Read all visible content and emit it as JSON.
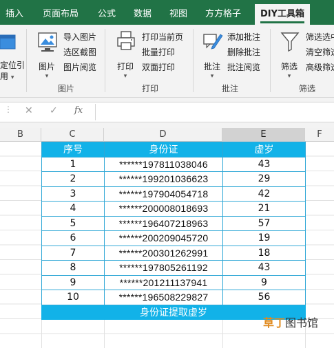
{
  "menu": {
    "tabs": [
      "插入",
      "页面布局",
      "公式",
      "数据",
      "视图",
      "方方格子",
      "DIY工具箱"
    ],
    "active_index": 6
  },
  "ribbon": {
    "partial_left": {
      "line1": "定位引",
      "line2": "用"
    },
    "groups": [
      {
        "label": "图片",
        "big": "图片",
        "small": [
          "导入图片",
          "选区截图",
          "图片阅览"
        ]
      },
      {
        "label": "打印",
        "big": "打印",
        "small": [
          "打印当前页",
          "批量打印",
          "双面打印"
        ]
      },
      {
        "label": "批注",
        "big": "批注",
        "small": [
          "添加批注",
          "删除批注",
          "批注阅览"
        ]
      },
      {
        "label": "筛选",
        "big": "筛选",
        "small": [
          "筛选选中",
          "清空筛选",
          "高级筛选"
        ]
      }
    ]
  },
  "formula_bar": {
    "fx": "fx",
    "value": ""
  },
  "sheet": {
    "columns": [
      "B",
      "C",
      "D",
      "E",
      "F"
    ],
    "selected_column": "E",
    "table": {
      "headers": [
        "序号",
        "身份证",
        "虚岁"
      ],
      "rows": [
        [
          "1",
          "******197811038046",
          "43"
        ],
        [
          "2",
          "******199201036623",
          "29"
        ],
        [
          "3",
          "******197904054718",
          "42"
        ],
        [
          "4",
          "******200008018693",
          "21"
        ],
        [
          "5",
          "******196407218963",
          "57"
        ],
        [
          "6",
          "******200209045720",
          "19"
        ],
        [
          "7",
          "******200301262991",
          "18"
        ],
        [
          "8",
          "******197805261192",
          "43"
        ],
        [
          "9",
          "******201211137941",
          "9"
        ],
        [
          "10",
          "******196508229827",
          "56"
        ]
      ],
      "footer": "身份证提取虚岁"
    }
  },
  "watermark": {
    "left": "草丁",
    "right": "图书馆"
  },
  "colors": {
    "excel_green": "#217346",
    "table_header": "#12b2e8",
    "table_border": "#2ea7d6"
  }
}
